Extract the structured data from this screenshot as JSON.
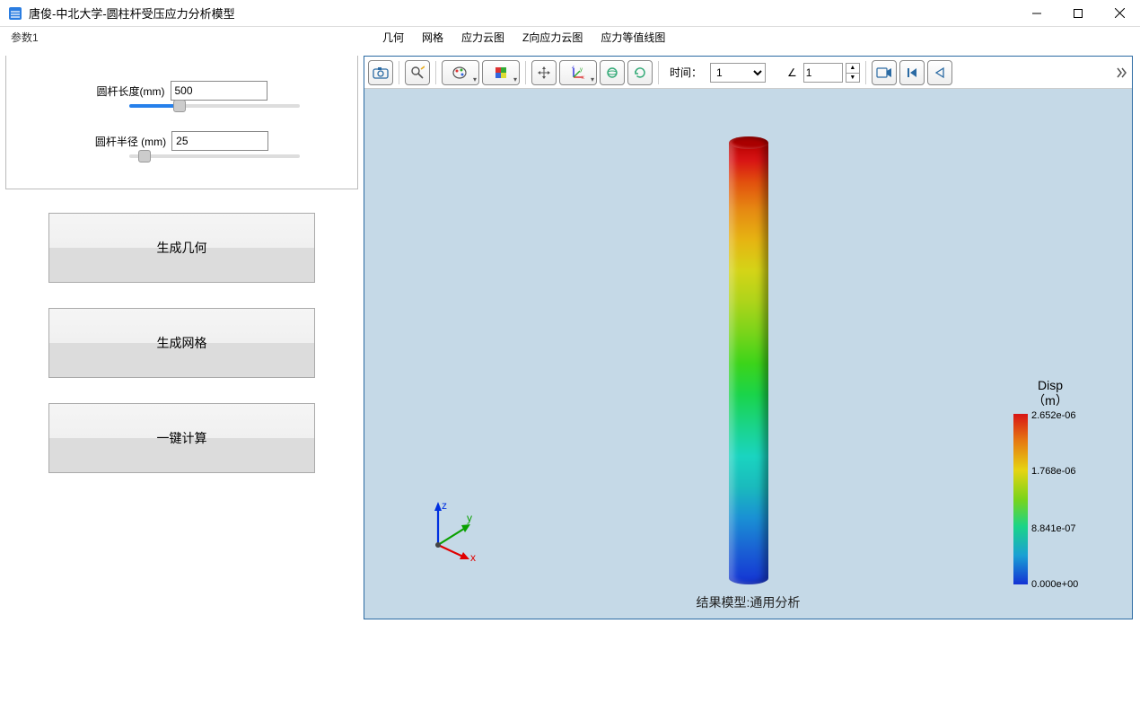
{
  "window": {
    "title": "唐俊-中北大学-圆柱杆受压应力分析模型"
  },
  "sidebar": {
    "tab_label": "参数1"
  },
  "params": {
    "length_label": "圆杆长度(mm)",
    "length_value": "500",
    "radius_label": "圆杆半径 (mm)",
    "radius_value": "25"
  },
  "buttons": {
    "gen_geom": "生成几何",
    "gen_mesh": "生成网格",
    "compute": "一键计算"
  },
  "menu": {
    "items": [
      "几何",
      "网格",
      "应力云图",
      "Z向应力云图",
      "应力等值线图"
    ]
  },
  "toolbar": {
    "time_label": "时间：",
    "time_select": "1",
    "spin_value": "1"
  },
  "viewport": {
    "caption": "结果模型:通用分析",
    "axes": {
      "x": "x",
      "y": "y",
      "z": "z"
    }
  },
  "legend": {
    "title_line1": "Disp",
    "title_line2": "（m）",
    "ticks": [
      "2.652e-06",
      "1.768e-06",
      "8.841e-07",
      "0.000e+00"
    ]
  }
}
